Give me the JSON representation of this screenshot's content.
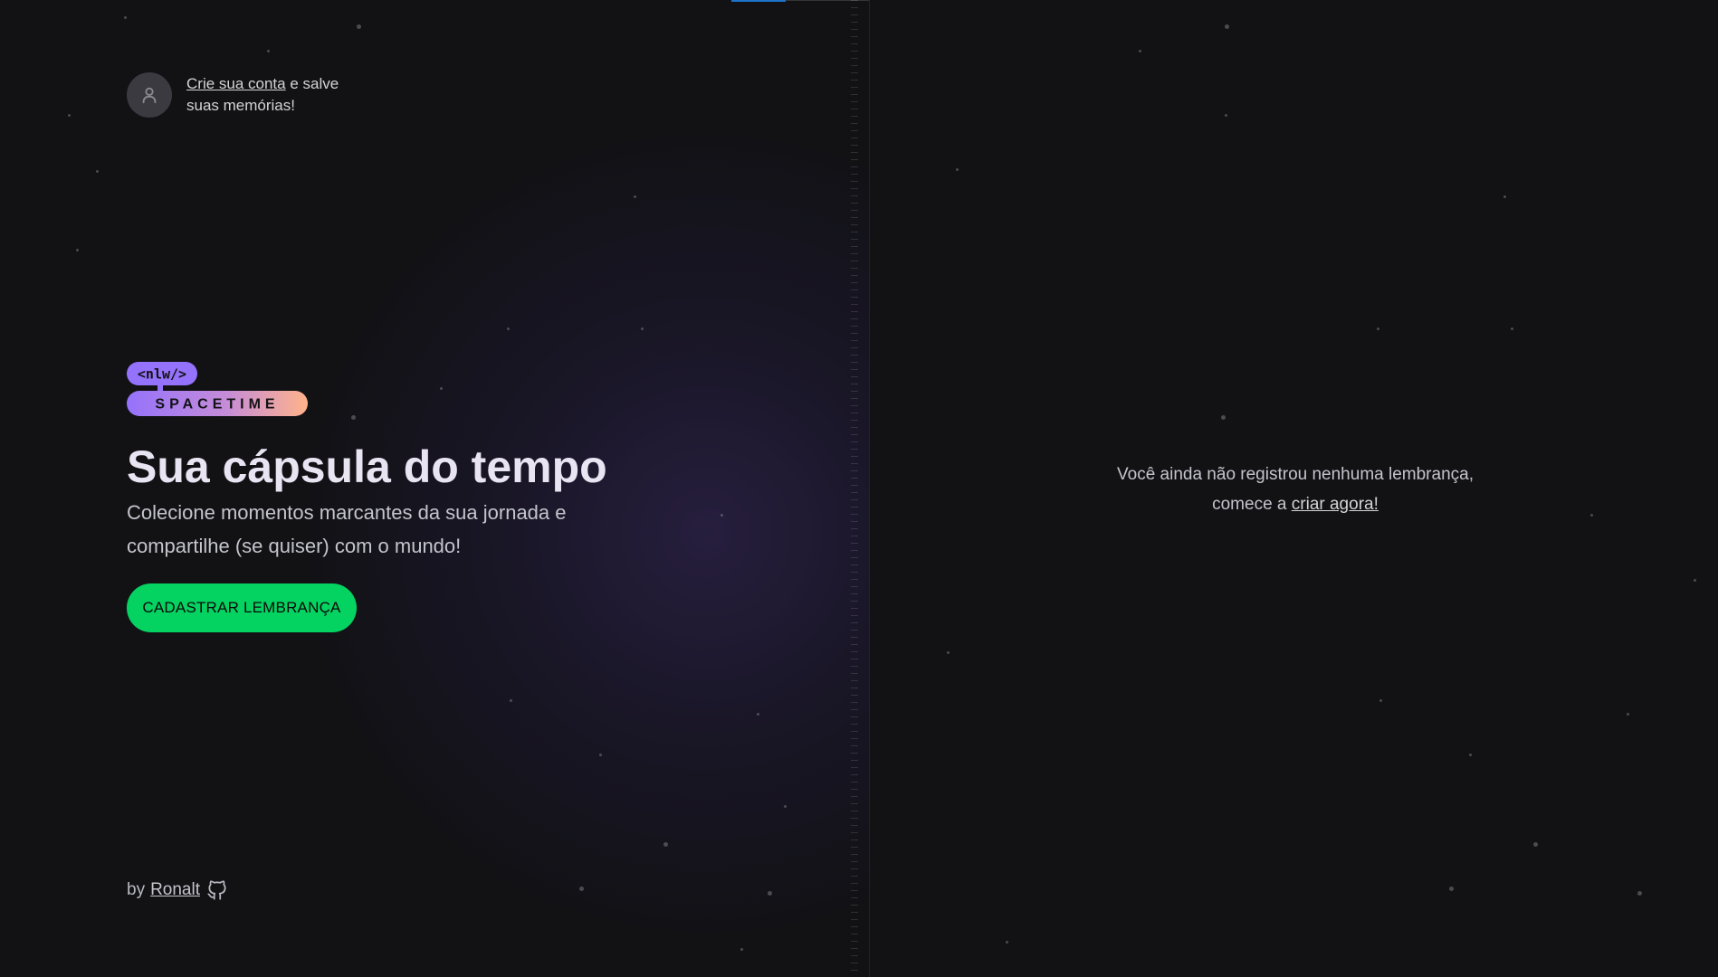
{
  "signin": {
    "link_label": "Crie sua conta",
    "suffix": " e salve suas memórias!"
  },
  "logo": {
    "tag": "<nlw/>",
    "word": "SPACETIME"
  },
  "hero": {
    "title": "Sua cápsula do tempo",
    "subtitle": "Colecione momentos marcantes da sua jornada e compartilhe (se quiser) com o mundo!",
    "cta_label": "CADASTRAR LEMBRANÇA"
  },
  "footer": {
    "by": "by",
    "author": "Ronalt"
  },
  "empty_state": {
    "line1": "Você ainda não registrou nenhuma lembrança,",
    "line2_prefix": "comece a ",
    "line2_link": "criar agora!"
  },
  "colors": {
    "background": "#121215",
    "accent_green": "#04d361",
    "logo_purple": "#9572fc",
    "logo_orange": "#ffb38a"
  },
  "icons": {
    "avatar": "user-icon",
    "footer": "github-icon"
  }
}
